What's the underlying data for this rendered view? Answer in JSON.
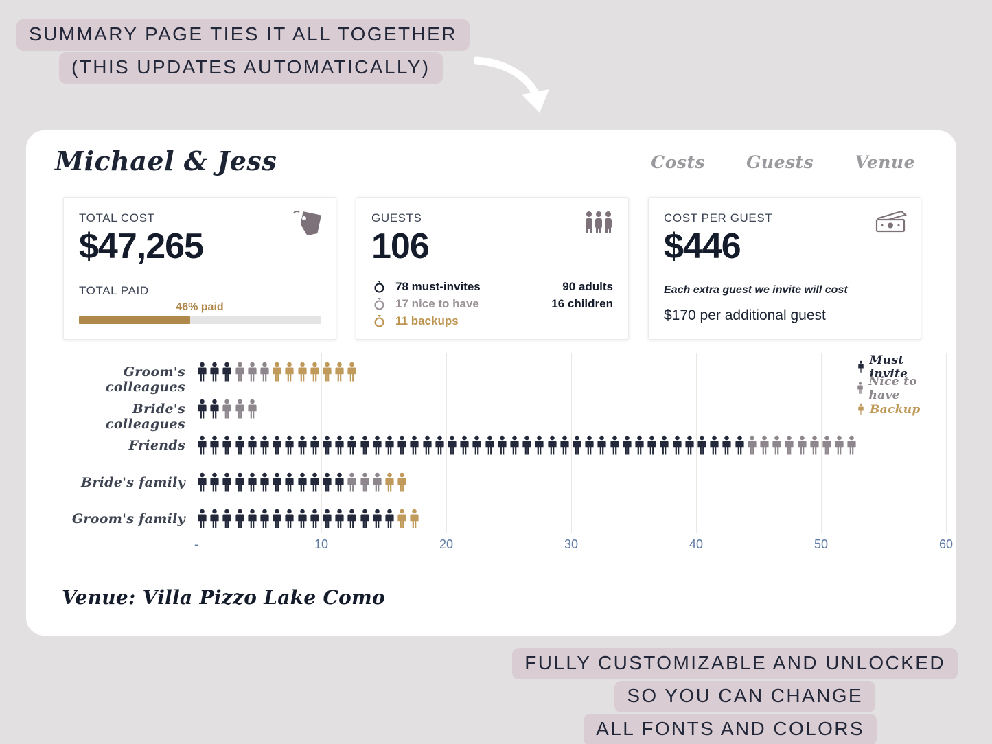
{
  "annotations": {
    "top": [
      "SUMMARY PAGE TIES IT ALL TOGETHER",
      "(THIS UPDATES AUTOMATICALLY)"
    ],
    "bottom": [
      "FULLY CUSTOMIZABLE AND UNLOCKED",
      "SO YOU CAN CHANGE",
      "ALL FONTS AND COLORS"
    ]
  },
  "header": {
    "couple_title": "Michael & Jess",
    "nav": [
      {
        "label": "Costs"
      },
      {
        "label": "Guests"
      },
      {
        "label": "Venue"
      }
    ]
  },
  "cards": {
    "total_cost": {
      "label": "TOTAL COST",
      "value": "$47,265",
      "paid_label": "TOTAL PAID",
      "progress_text": "46% paid",
      "progress_percent": 46,
      "icon": "price-tag-icon"
    },
    "guests": {
      "label": "GUESTS",
      "value": "106",
      "icon": "three-people-icon",
      "breakdown": [
        {
          "text": "78 must-invites",
          "color": "#141b2a"
        },
        {
          "text": "17 nice to have",
          "color": "#9a9298"
        },
        {
          "text": "11 backups",
          "color": "#bd944f"
        }
      ],
      "totals": [
        "90 adults",
        "16 children"
      ]
    },
    "cost_per_guest": {
      "label": "COST PER GUEST",
      "value": "$446",
      "icon": "money-cash-icon",
      "note": "Each extra guest we invite will cost",
      "detail": "$170 per additional guest"
    }
  },
  "chart_data": {
    "type": "bar",
    "title": "",
    "xlabel": "",
    "ylabel": "",
    "xlim": [
      0,
      60
    ],
    "tick_labels": [
      "-",
      "10",
      "20",
      "30",
      "40",
      "50",
      "60"
    ],
    "tick_values": [
      0,
      10,
      20,
      30,
      40,
      50,
      60
    ],
    "grid": true,
    "legend_position": "right",
    "legend": [
      {
        "name": "Must invite",
        "color": "#23293a"
      },
      {
        "name": "Nice to have",
        "color": "#8d868c"
      },
      {
        "name": "Backup",
        "color": "#c09a5b"
      }
    ],
    "categories": [
      "Groom's colleagues",
      "Bride's colleagues",
      "Friends",
      "Bride's family",
      "Groom's family"
    ],
    "series": [
      {
        "name": "Must invite",
        "values": [
          3,
          2,
          44,
          12,
          16
        ]
      },
      {
        "name": "Nice to have",
        "values": [
          3,
          3,
          9,
          3,
          0
        ]
      },
      {
        "name": "Backup",
        "values": [
          7,
          0,
          0,
          2,
          2
        ]
      }
    ],
    "totals": [
      13,
      5,
      53,
      17,
      18
    ]
  },
  "venue": {
    "text": "Venue: Villa Pizzo Lake Como"
  }
}
